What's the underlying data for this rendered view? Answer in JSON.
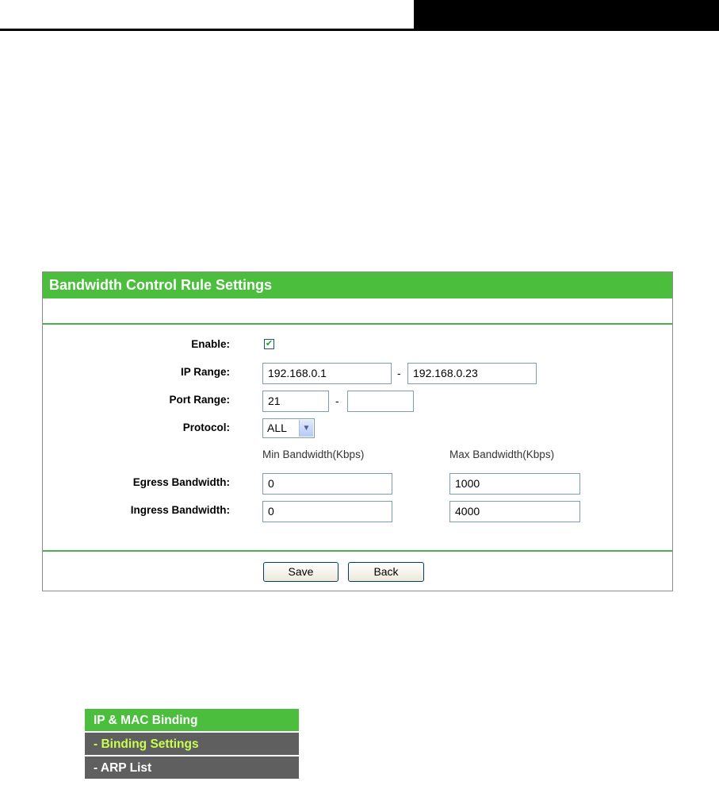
{
  "panel": {
    "title": "Bandwidth Control Rule Settings",
    "labels": {
      "enable": "Enable:",
      "ip_range": "IP Range:",
      "port_range": "Port Range:",
      "protocol": "Protocol:",
      "egress": "Egress Bandwidth:",
      "ingress": "Ingress Bandwidth:"
    },
    "enable_checked": true,
    "enable_mark": "✔",
    "ip_start": "192.168.0.1",
    "ip_end": "192.168.0.23",
    "port_start": "21",
    "port_end": "",
    "range_separator": "-",
    "protocol": "ALL",
    "dropdown_arrow": "▼",
    "min_bandwidth_header": "Min Bandwidth(Kbps)",
    "max_bandwidth_header": "Max Bandwidth(Kbps)",
    "egress_min": "0",
    "egress_max": "1000",
    "ingress_min": "0",
    "ingress_max": "4000",
    "save_label": "Save",
    "back_label": "Back"
  },
  "menu": {
    "items": [
      {
        "label": "IP & MAC Binding"
      },
      {
        "label": "- Binding Settings"
      },
      {
        "label": "- ARP List"
      }
    ]
  },
  "colors": {
    "accent_green": "#4cbe3e",
    "menu_gray": "#5f5f5f",
    "current_submenu_text": "#c8ff50"
  }
}
